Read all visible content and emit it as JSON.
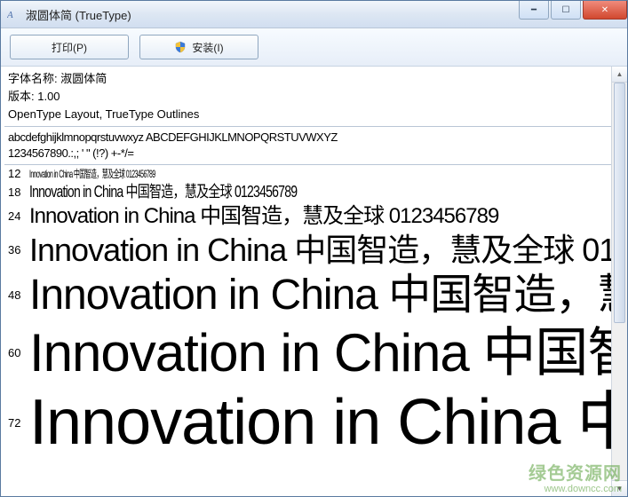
{
  "window": {
    "title": "淑圆体简 (TrueType)"
  },
  "toolbar": {
    "print_label": "打印(P)",
    "install_label": "安装(I)"
  },
  "meta": {
    "font_name_line": "字体名称: 淑圆体简",
    "version_line": "版本: 1.00",
    "tech_line": "OpenType Layout, TrueType Outlines"
  },
  "charset": {
    "line1": "abcdefghijklmnopqrstuvwxyz  ABCDEFGHIJKLMNOPQRSTUVWXYZ",
    "line2": "1234567890.:,; ' \" (!?) +-*/="
  },
  "sample_text": "Innovation in China  中国智造，慧及全球 0123456789",
  "sizes": [
    12,
    18,
    24,
    36,
    48,
    60,
    72
  ],
  "watermark": {
    "line1": "绿色资源网",
    "line2": "www.downcc.com"
  }
}
